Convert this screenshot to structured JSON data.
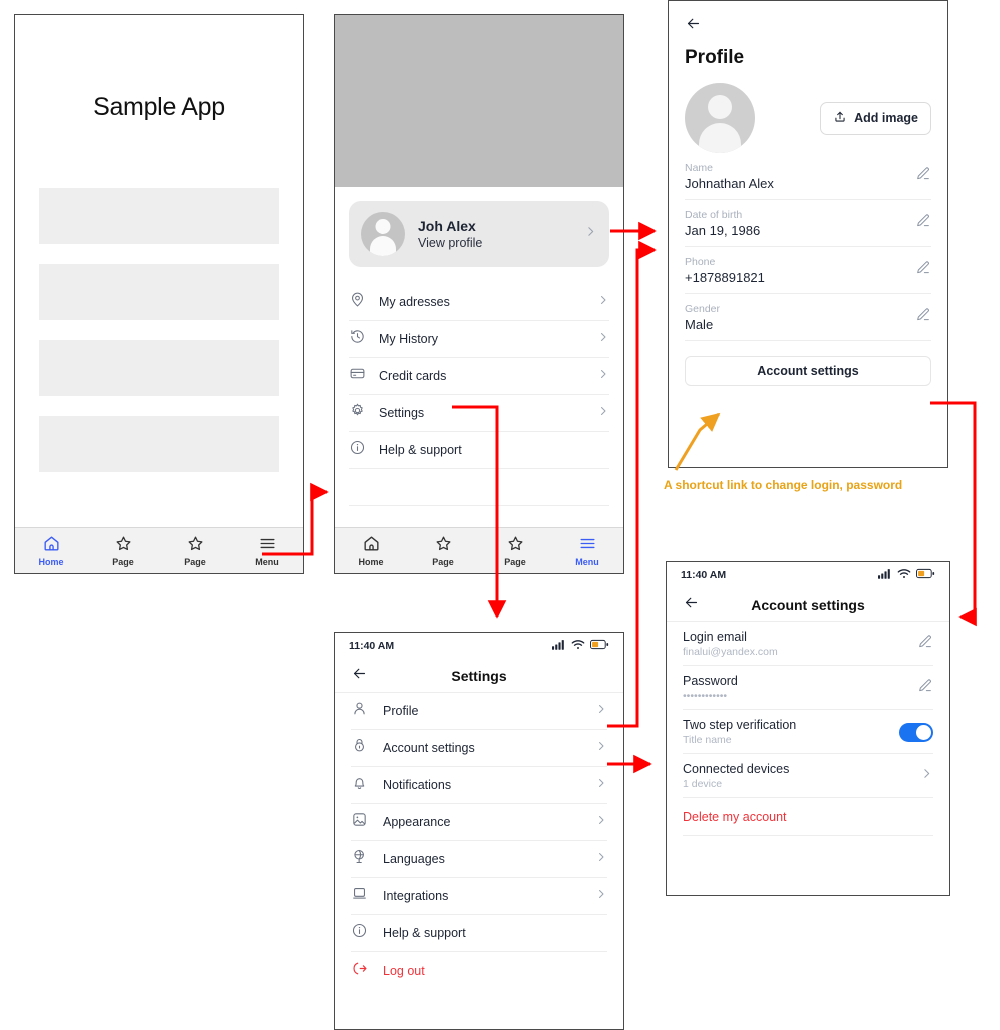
{
  "colors": {
    "accent_blue": "#3b5cf5",
    "toggle_blue": "#1a73f0",
    "danger_red": "#f0333a",
    "connector_red": "#ff0000",
    "annotation_orange": "#e8a317",
    "placeholder_gray": "#eeeeee",
    "hero_gray": "#bdbdbd"
  },
  "screen_home": {
    "title": "Sample App",
    "placeholder_blocks": 4,
    "tabbar": [
      {
        "icon": "home-icon",
        "label": "Home",
        "active": true
      },
      {
        "icon": "star-icon",
        "label": "Page",
        "active": false
      },
      {
        "icon": "star-icon",
        "label": "Page",
        "active": false
      },
      {
        "icon": "hamburger-icon",
        "label": "Menu",
        "active": false
      }
    ]
  },
  "screen_menu": {
    "profile_card": {
      "name": "Joh Alex",
      "subtitle": "View profile",
      "chevron": "›"
    },
    "items": [
      {
        "icon": "location-pin-icon",
        "label": "My adresses",
        "chevron": true
      },
      {
        "icon": "history-clock-icon",
        "label": "My History",
        "chevron": true
      },
      {
        "icon": "credit-card-icon",
        "label": "Credit cards",
        "chevron": true
      },
      {
        "icon": "gear-icon",
        "label": "Settings",
        "chevron": true
      },
      {
        "icon": "info-circle-icon",
        "label": "Help & support",
        "chevron": false
      }
    ],
    "tabbar": [
      {
        "icon": "home-icon",
        "label": "Home",
        "active": false
      },
      {
        "icon": "star-icon",
        "label": "Page",
        "active": false
      },
      {
        "icon": "star-icon",
        "label": "Page",
        "active": false
      },
      {
        "icon": "hamburger-icon",
        "label": "Menu",
        "active": true
      }
    ]
  },
  "screen_profile": {
    "back_icon": "arrow-left-icon",
    "title": "Profile",
    "add_image_label": "Add image",
    "fields": [
      {
        "label": "Name",
        "value": "Johnathan Alex"
      },
      {
        "label": "Date of birth",
        "value": "Jan 19, 1986"
      },
      {
        "label": "Phone",
        "value": "+1878891821"
      },
      {
        "label": "Gender",
        "value": "Male"
      }
    ],
    "account_button": "Account settings"
  },
  "screen_settings": {
    "status_time": "11:40 AM",
    "back_icon": "arrow-left-icon",
    "title": "Settings",
    "items": [
      {
        "icon": "person-icon",
        "label": "Profile",
        "chevron": true,
        "danger": false
      },
      {
        "icon": "lock-icon",
        "label": "Account settings",
        "chevron": true,
        "danger": false
      },
      {
        "icon": "bell-icon",
        "label": "Notifications",
        "chevron": true,
        "danger": false
      },
      {
        "icon": "image-icon",
        "label": "Appearance",
        "chevron": true,
        "danger": false
      },
      {
        "icon": "globe-icon",
        "label": "Languages",
        "chevron": true,
        "danger": false
      },
      {
        "icon": "laptop-icon",
        "label": "Integrations",
        "chevron": true,
        "danger": false
      },
      {
        "icon": "info-circle-icon",
        "label": "Help & support",
        "chevron": false,
        "danger": false
      },
      {
        "icon": "logout-icon",
        "label": "Log out",
        "chevron": false,
        "danger": true
      }
    ]
  },
  "screen_account": {
    "status_time": "11:40 AM",
    "back_icon": "arrow-left-icon",
    "title": "Account settings",
    "rows": [
      {
        "title": "Login email",
        "sub": "finalui@yandex.com",
        "control": "pencil-icon"
      },
      {
        "title": "Password",
        "sub": "••••••••••••",
        "control": "pencil-icon"
      },
      {
        "title": "Two step verification",
        "sub": "Title name",
        "control": "toggle-on"
      },
      {
        "title": "Connected devices",
        "sub": "1 device",
        "control": "chevron-icon"
      },
      {
        "title": "Delete my account",
        "sub": "",
        "control": "none",
        "danger": true
      }
    ]
  },
  "annotation": {
    "text": "A shortcut link to change login, password"
  }
}
